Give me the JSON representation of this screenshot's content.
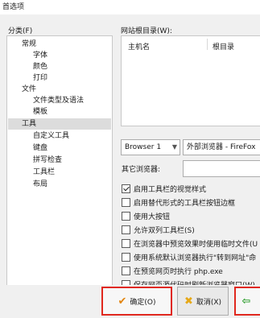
{
  "window": {
    "title": "首选项"
  },
  "categories": {
    "label": "分类(F)",
    "items": [
      {
        "label": "常规"
      },
      {
        "label": "字体"
      },
      {
        "label": "颜色"
      },
      {
        "label": "打印"
      },
      {
        "label": "文件"
      },
      {
        "label": "文件类型及语法"
      },
      {
        "label": "模板"
      },
      {
        "label": "工具"
      },
      {
        "label": "自定义工具"
      },
      {
        "label": "键盘"
      },
      {
        "label": "拼写检查"
      },
      {
        "label": "工具栏"
      },
      {
        "label": "布局"
      }
    ],
    "selected": "工具"
  },
  "site_root": {
    "label": "网站根目录(W):",
    "columns": [
      "主机名",
      "根目录"
    ]
  },
  "browser": {
    "selected": "Browser 1",
    "external_selected": "外部浏览器 - FireFox",
    "other_label": "其它浏览器:",
    "other_value": ""
  },
  "options": [
    {
      "label": "启用工具栏的视觉样式",
      "checked": true
    },
    {
      "label": "启用替代形式的工具栏按钮边框",
      "checked": false
    },
    {
      "label": "使用大按钮",
      "checked": false
    },
    {
      "label": "允许双列工具栏(S)",
      "checked": false
    },
    {
      "label": "在浏览器中预览效果时使用临时文件(U",
      "checked": false
    },
    {
      "label": "使用系统默认浏览器执行\"转到网址\"命",
      "checked": false
    },
    {
      "label": "在预览网页时执行 php.exe",
      "checked": false
    },
    {
      "label": "保存网页源代码时刷新浏览器窗口(W)",
      "checked": false
    }
  ],
  "buttons": {
    "ok": "确定(O)",
    "cancel": "取消(X)"
  },
  "colors": {
    "highlight_border": "#e0281e",
    "selected_bg": "#dcdcdc"
  }
}
